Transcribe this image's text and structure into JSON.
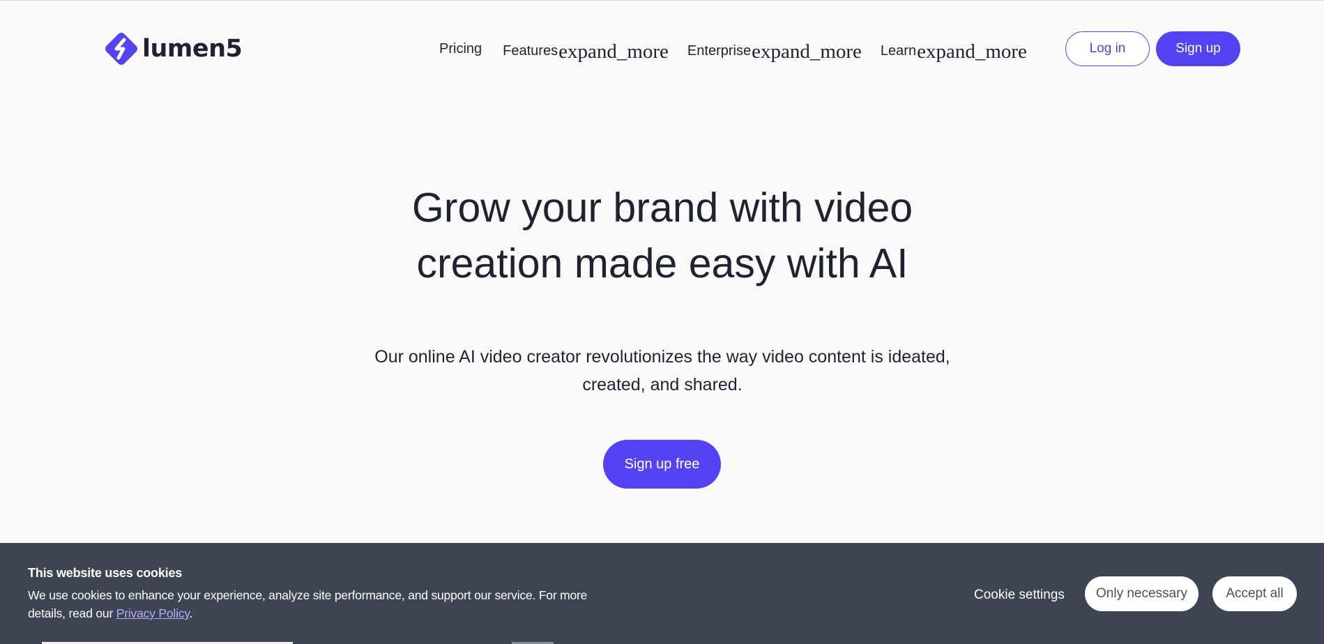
{
  "brand": {
    "name": "lumen5",
    "accent_color": "#5443f2",
    "logo_icon": "lumen5-logo-icon"
  },
  "nav": {
    "pricing": "Pricing",
    "features": "Features",
    "enterprise": "Enterprise",
    "learn": "Learn",
    "expand_glyph": "expand_more",
    "login": "Log in",
    "signup": "Sign up"
  },
  "hero": {
    "title_line1": "Grow your brand with video",
    "title_line2": "creation made easy with AI",
    "subtitle_line1": "Our online AI video creator revolutionizes the way video content is ideated,",
    "subtitle_line2": "created, and shared.",
    "cta": "Sign up free"
  },
  "cookie_banner": {
    "title": "This website uses cookies",
    "text_line1": "We use cookies to enhance your experience, analyze site performance, and support our service. For more",
    "text_line2_prefix": "details, read our ",
    "privacy_link": "Privacy Policy",
    "text_line2_suffix": ".",
    "settings": "Cookie settings",
    "only_necessary": "Only necessary",
    "accept_all": "Accept all",
    "background_color": "#3e4451"
  }
}
